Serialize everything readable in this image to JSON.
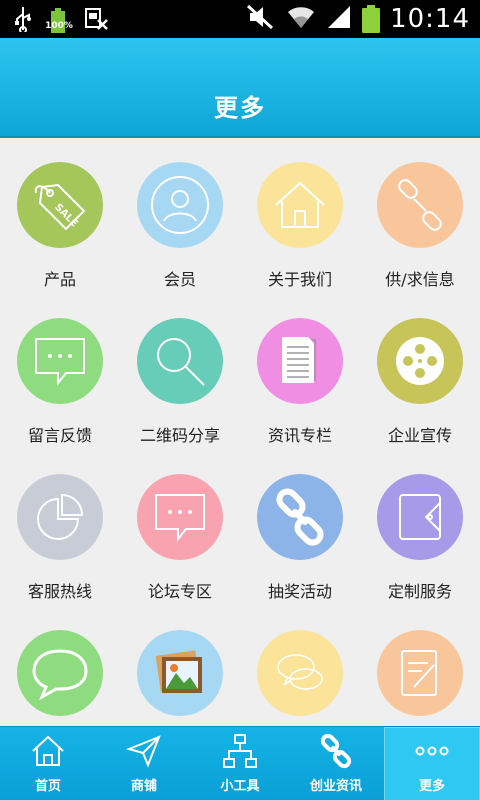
{
  "status_bar": {
    "battery_small_label": "100%",
    "time": "10:14"
  },
  "header": {
    "title": "更多"
  },
  "grid": {
    "items": [
      {
        "label": "产品",
        "icon": "sale-tag-icon",
        "color": "#a4c65a"
      },
      {
        "label": "会员",
        "icon": "user-icon",
        "color": "#a6d8f4"
      },
      {
        "label": "关于我们",
        "icon": "house-icon",
        "color": "#fbe49a"
      },
      {
        "label": "供/求信息",
        "icon": "link-icon",
        "color": "#f8c69a"
      },
      {
        "label": "留言反馈",
        "icon": "chat-bubble-icon",
        "color": "#8fdc80"
      },
      {
        "label": "二维码分享",
        "icon": "magnifier-icon",
        "color": "#68cdb8"
      },
      {
        "label": "资讯专栏",
        "icon": "document-icon",
        "color": "#f08ee4"
      },
      {
        "label": "企业宣传",
        "icon": "film-reel-icon",
        "color": "#c7c45a"
      },
      {
        "label": "客服热线",
        "icon": "pie-chart-icon",
        "color": "#c8ccd6"
      },
      {
        "label": "论坛专区",
        "icon": "forum-bubble-icon",
        "color": "#f9a3b0"
      },
      {
        "label": "抽奖活动",
        "icon": "chain-icon",
        "color": "#8db4e8"
      },
      {
        "label": "定制服务",
        "icon": "wallet-icon",
        "color": "#a79ae8"
      },
      {
        "label": "",
        "icon": "speech-bubble-icon",
        "color": "#8fdc80"
      },
      {
        "label": "",
        "icon": "picture-icon",
        "color": "#a6d8f4"
      },
      {
        "label": "",
        "icon": "dual-bubble-icon",
        "color": "#fbe49a"
      },
      {
        "label": "",
        "icon": "edit-note-icon",
        "color": "#f8c69a"
      }
    ]
  },
  "tab_bar": {
    "tabs": [
      {
        "label": "首页",
        "icon": "home-icon"
      },
      {
        "label": "商铺",
        "icon": "send-icon"
      },
      {
        "label": "小工具",
        "icon": "sitemap-icon"
      },
      {
        "label": "创业资讯",
        "icon": "chain-icon"
      },
      {
        "label": "更多",
        "icon": "more-dots-icon"
      }
    ],
    "active_index": 4
  }
}
